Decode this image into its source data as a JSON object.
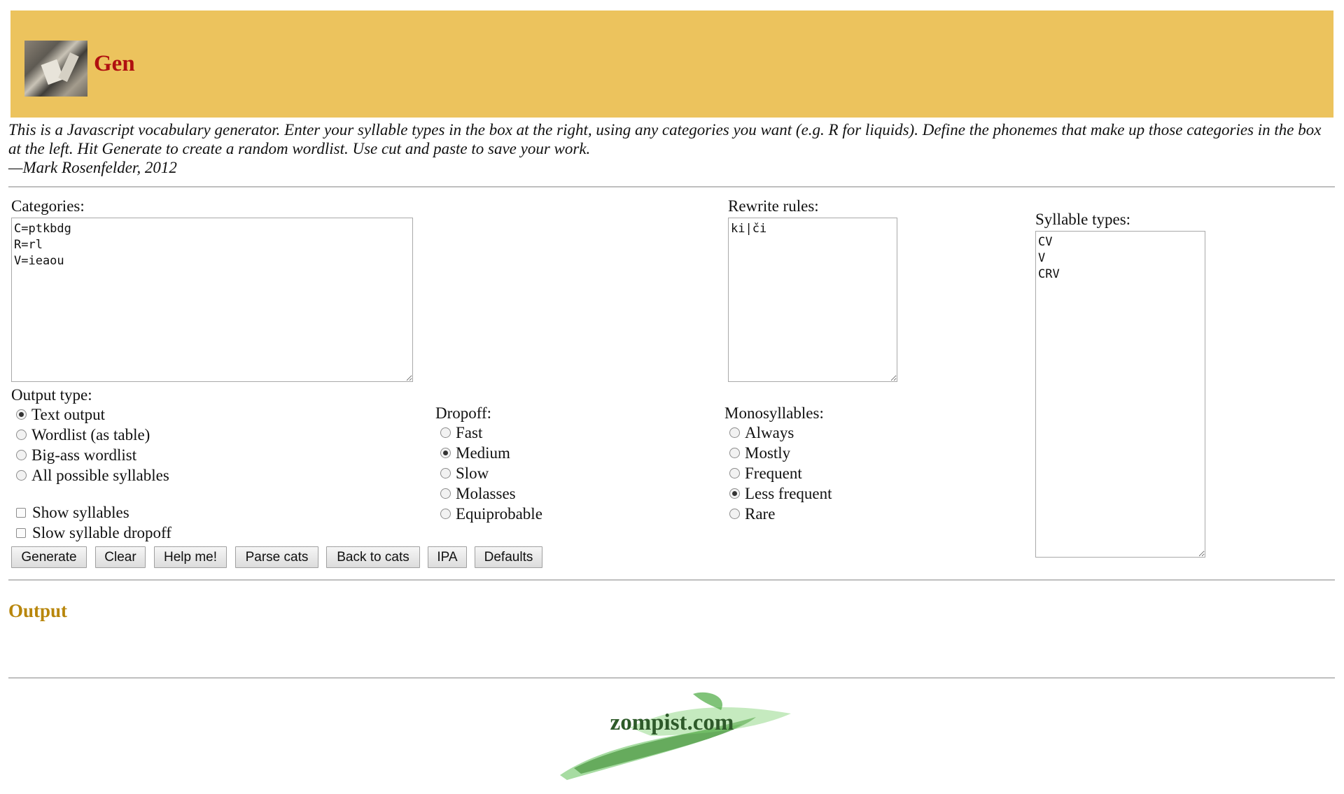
{
  "header": {
    "title": "Gen",
    "logo_icon": "gen-logo-icon"
  },
  "intro": {
    "text": "This is a Javascript vocabulary generator. Enter your syllable types in the box at the right, using any categories you want (e.g. R for liquids). Define the phonemes that make up those categories in the box at the left. Hit Generate to create a random wordlist. Use cut and paste to save your work.",
    "signature": "—Mark Rosenfelder, 2012"
  },
  "categories": {
    "label": "Categories:",
    "value": "C=ptkbdg\nR=rl\nV=ieaou"
  },
  "rewrite": {
    "label": "Rewrite rules:",
    "value": "ki|či"
  },
  "syllables": {
    "label": "Syllable types:",
    "value": "CV\nV\nCRV"
  },
  "output_type": {
    "label": "Output type:",
    "options": [
      "Text output",
      "Wordlist (as table)",
      "Big-ass wordlist",
      "All possible syllables"
    ],
    "selected": "Text output"
  },
  "checkboxes": {
    "show_syllables": "Show syllables",
    "slow_dropoff": "Slow syllable dropoff"
  },
  "dropoff": {
    "label": "Dropoff:",
    "options": [
      "Fast",
      "Medium",
      "Slow",
      "Molasses",
      "Equiprobable"
    ],
    "selected": "Medium"
  },
  "monosyllables": {
    "label": "Monosyllables:",
    "options": [
      "Always",
      "Mostly",
      "Frequent",
      "Less frequent",
      "Rare"
    ],
    "selected": "Less frequent"
  },
  "buttons": {
    "generate": "Generate",
    "clear": "Clear",
    "help": "Help me!",
    "parse": "Parse cats",
    "back": "Back to cats",
    "ipa": "IPA",
    "defaults": "Defaults"
  },
  "output": {
    "title": "Output"
  },
  "footer": {
    "logo_text": "zompist.com",
    "logo_icon": "zompist-logo-icon"
  },
  "colors": {
    "header_bg": "#ecc35d",
    "title_red": "#b01010",
    "output_gold": "#b8860b",
    "logo_green": "#3a8a2e"
  }
}
